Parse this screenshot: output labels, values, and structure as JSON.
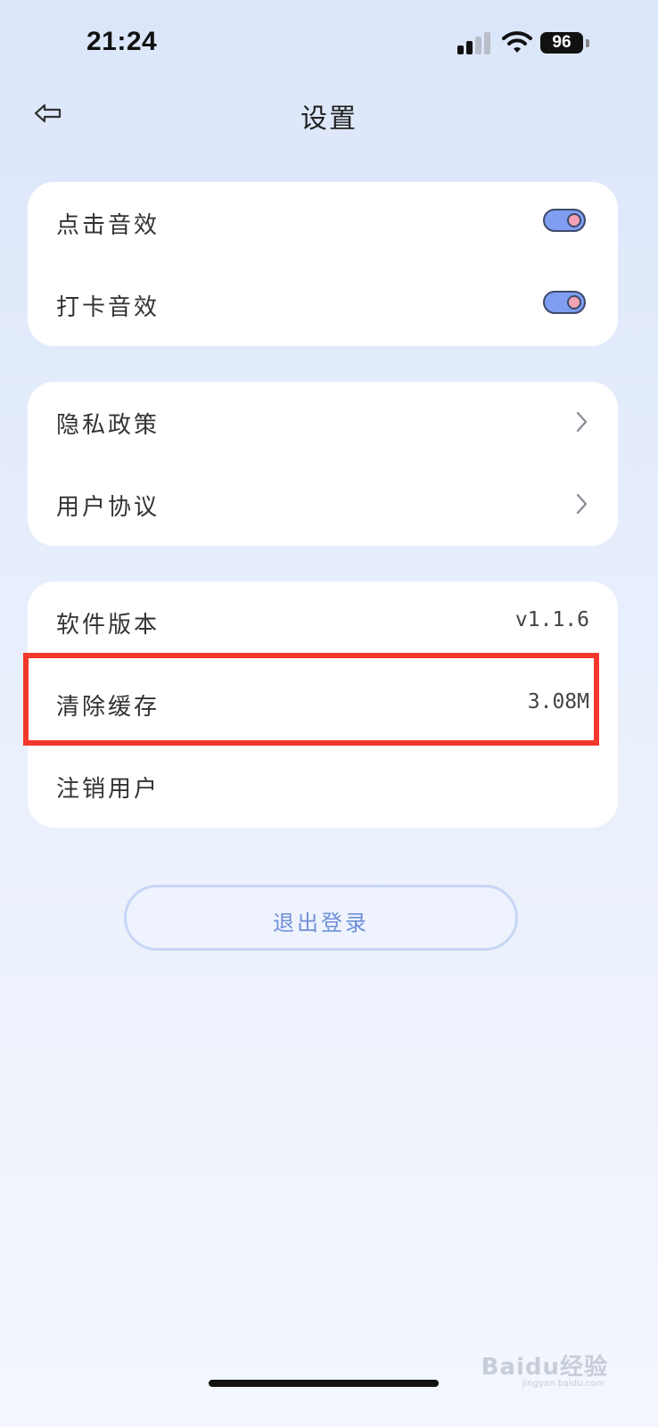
{
  "status_bar": {
    "time": "21:24",
    "battery_level": "96",
    "signal_bars_active": 2,
    "signal_bars_total": 4
  },
  "header": {
    "title": "设置",
    "back_icon": "back-arrow-icon"
  },
  "cards": {
    "sound": {
      "items": [
        {
          "label": "点击音效",
          "toggle_on": true
        },
        {
          "label": "打卡音效",
          "toggle_on": true
        }
      ]
    },
    "legal": {
      "items": [
        {
          "label": "隐私政策",
          "icon": "chevron-right-icon"
        },
        {
          "label": "用户协议",
          "icon": "chevron-right-icon"
        }
      ]
    },
    "app": {
      "items": [
        {
          "label": "软件版本",
          "value": "v1.1.6"
        },
        {
          "label": "清除缓存",
          "value": "3.08M"
        },
        {
          "label": "注销用户"
        }
      ]
    }
  },
  "logout_label": "退出登录",
  "watermark": {
    "text": "Baidu经验",
    "sub": "jingyan.baidu.com"
  },
  "colors": {
    "toggle_track": "#7f9ef2",
    "toggle_knob": "#f4a3b6",
    "highlight_border": "#f2372b",
    "logout_text": "#6f8fd8"
  }
}
